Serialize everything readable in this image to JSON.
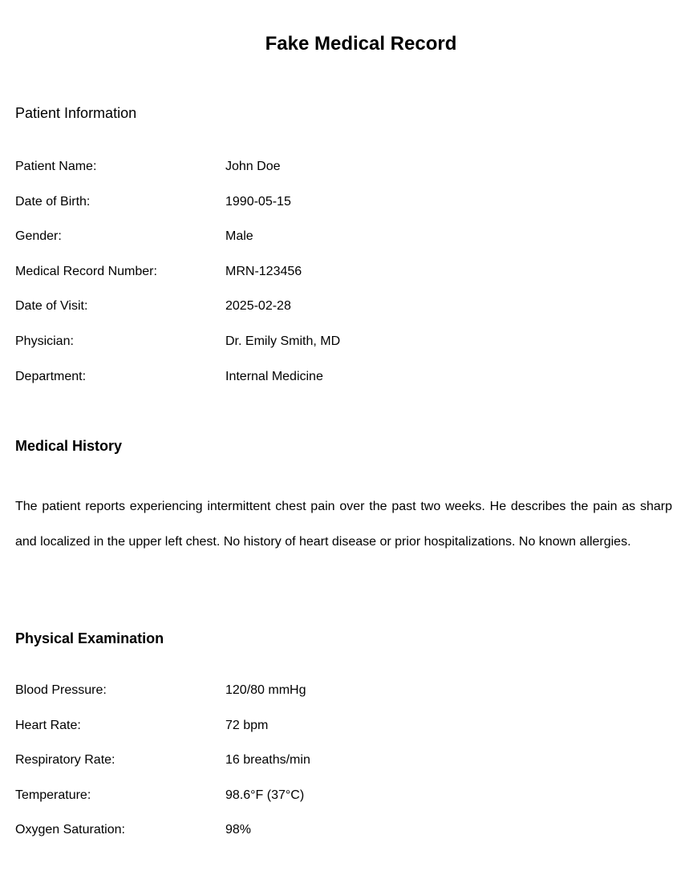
{
  "document": {
    "title": "Fake Medical Record"
  },
  "patient_info": {
    "heading": "Patient Information",
    "fields": [
      {
        "label": "Patient Name:",
        "value": "John Doe"
      },
      {
        "label": "Date of Birth:",
        "value": "1990-05-15"
      },
      {
        "label": "Gender:",
        "value": "Male"
      },
      {
        "label": "Medical Record Number:",
        "value": "MRN-123456"
      },
      {
        "label": "Date of Visit:",
        "value": "2025-02-28"
      },
      {
        "label": "Physician:",
        "value": "Dr. Emily Smith, MD"
      },
      {
        "label": "Department:",
        "value": "Internal Medicine"
      }
    ]
  },
  "medical_history": {
    "heading": "Medical History",
    "text": "The patient reports experiencing intermittent chest pain over the past two weeks. He describes the pain as sharp and localized in the upper left chest. No history of heart disease or prior hospitalizations. No known allergies."
  },
  "physical_exam": {
    "heading": "Physical Examination",
    "fields": [
      {
        "label": "Blood Pressure:",
        "value": "120/80 mmHg"
      },
      {
        "label": "Heart Rate:",
        "value": "72 bpm"
      },
      {
        "label": "Respiratory Rate:",
        "value": "16 breaths/min"
      },
      {
        "label": "Temperature:",
        "value": "98.6°F (37°C)"
      },
      {
        "label": "Oxygen Saturation:",
        "value": "98%"
      }
    ]
  }
}
